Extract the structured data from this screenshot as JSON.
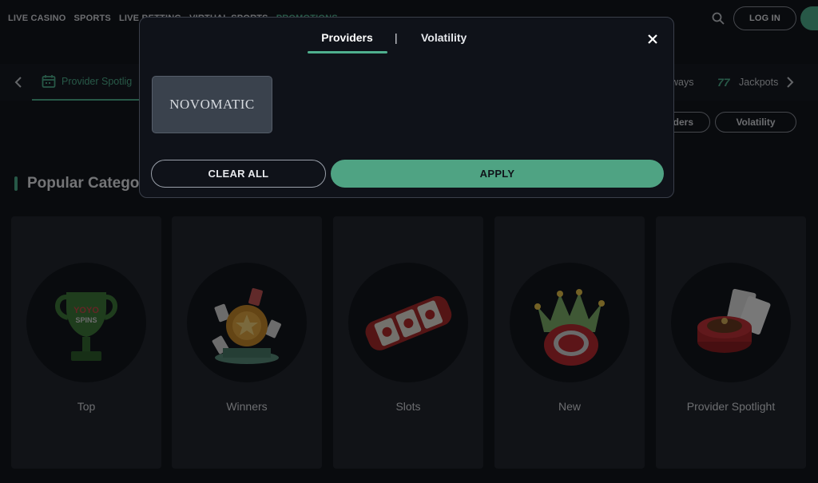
{
  "topnav": {
    "items": [
      "LIVE CASINO",
      "SPORTS",
      "LIVE BETTING",
      "VIRTUAL SPORTS",
      "PROMOTIONS"
    ],
    "active_index": 4,
    "login_label": "LOG IN",
    "accent_color": "#4fb08e"
  },
  "category_bar": {
    "tabs": [
      {
        "label": "Provider Spotlig",
        "icon": "calendar-icon",
        "active": true
      },
      {
        "label": "ways",
        "icon": "",
        "active": false
      },
      {
        "label": "Jackpots",
        "icon": "sevens-icon",
        "active": false
      }
    ]
  },
  "filters": {
    "providers_label": "ders",
    "volatility_label": "Volatility"
  },
  "section": {
    "title": "Popular Catego"
  },
  "cards": [
    {
      "label": "Top",
      "icon": "trophy-icon"
    },
    {
      "label": "Winners",
      "icon": "award-icon"
    },
    {
      "label": "Slots",
      "icon": "slot-reels-icon"
    },
    {
      "label": "New",
      "icon": "crown-chip-icon"
    },
    {
      "label": "Provider Spotlight",
      "icon": "roulette-icon"
    }
  ],
  "modal": {
    "tabs": [
      {
        "label": "Providers",
        "active": true
      },
      {
        "label": "Volatility",
        "active": false
      }
    ],
    "separator": "|",
    "providers": [
      {
        "name": "NOVOMATIC",
        "selected": false
      }
    ],
    "clear_label": "CLEAR ALL",
    "apply_label": "APPLY",
    "apply_color": "#4fa383"
  }
}
